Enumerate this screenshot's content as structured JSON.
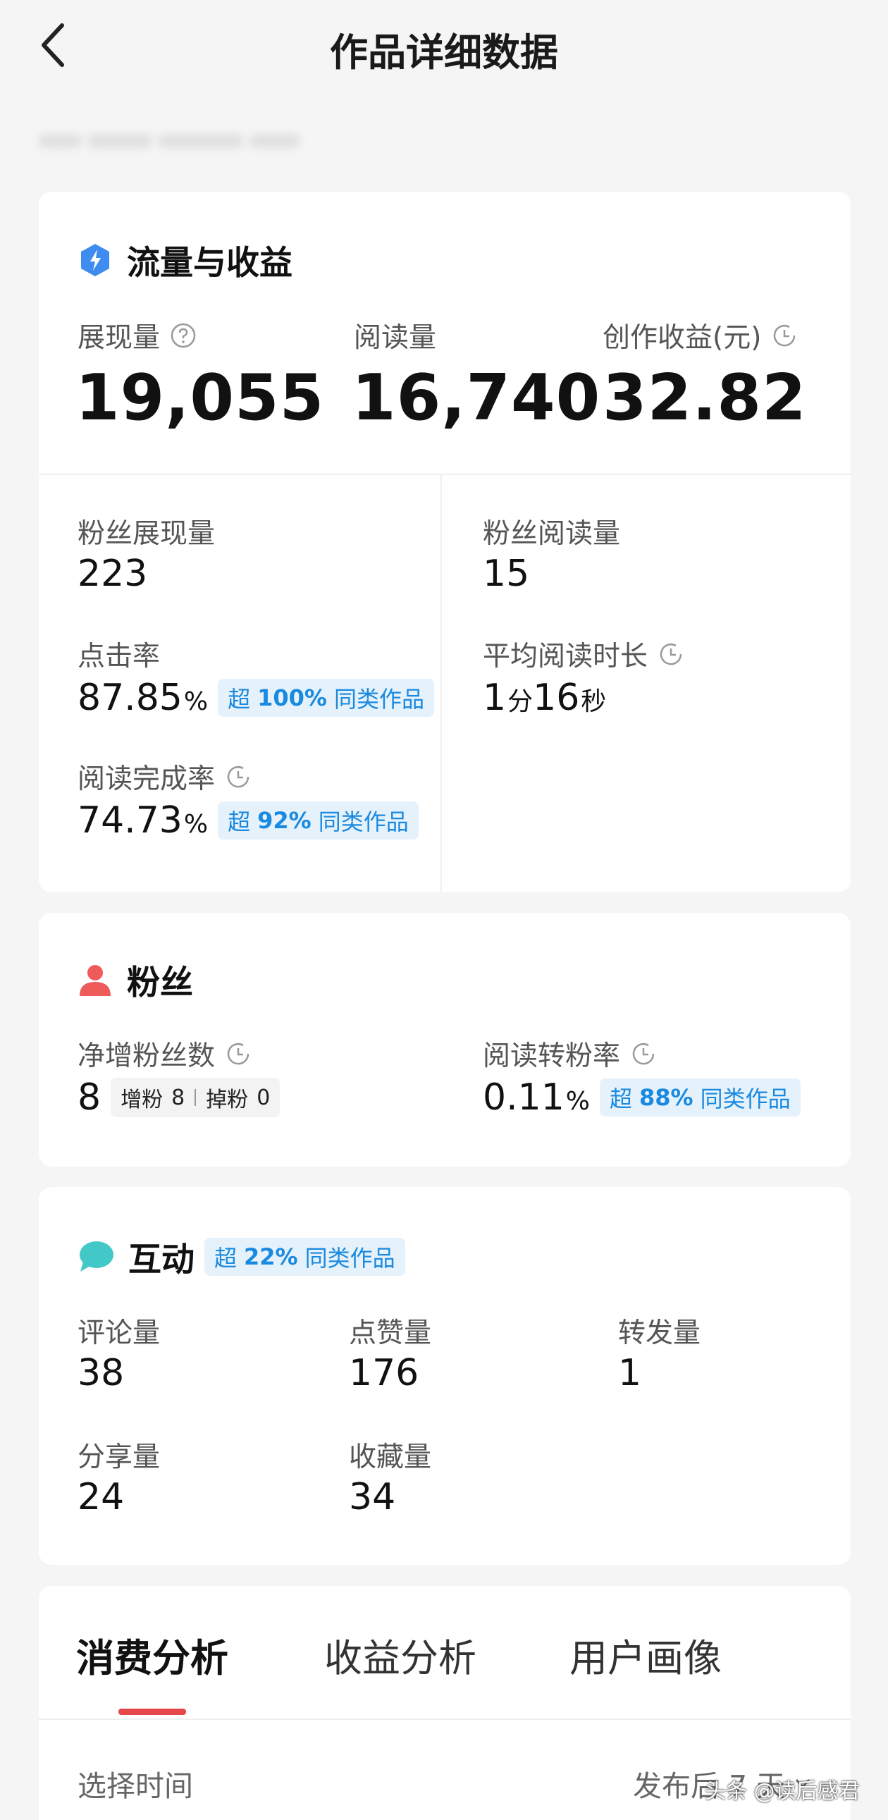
{
  "header": {
    "title": "作品详细数据"
  },
  "traffic": {
    "title": "流量与收益",
    "impressions": {
      "label": "展现量",
      "value": "19,055"
    },
    "reads": {
      "label": "阅读量",
      "value": "16,740"
    },
    "earnings": {
      "label": "创作收益(元)",
      "value": "32.82"
    },
    "fan_impressions": {
      "label": "粉丝展现量",
      "value": "223"
    },
    "fan_reads": {
      "label": "粉丝阅读量",
      "value": "15"
    },
    "ctr": {
      "label": "点击率",
      "value": "87.85",
      "unit": "%",
      "badge_prefix": "超",
      "badge_pct": "100%",
      "badge_suffix": "同类作品"
    },
    "avg_read_time": {
      "label": "平均阅读时长",
      "min": "1",
      "min_unit": "分",
      "sec": "16",
      "sec_unit": "秒"
    },
    "completion": {
      "label": "阅读完成率",
      "value": "74.73",
      "unit": "%",
      "badge_prefix": "超",
      "badge_pct": "92%",
      "badge_suffix": "同类作品"
    }
  },
  "fans": {
    "title": "粉丝",
    "net_gain": {
      "label": "净增粉丝数",
      "value": "8",
      "gain_label": "增粉",
      "gain": "8",
      "loss_label": "掉粉",
      "loss": "0"
    },
    "conversion": {
      "label": "阅读转粉率",
      "value": "0.11",
      "unit": "%",
      "badge_prefix": "超",
      "badge_pct": "88%",
      "badge_suffix": "同类作品"
    }
  },
  "interaction": {
    "title": "互动",
    "badge_prefix": "超",
    "badge_pct": "22%",
    "badge_suffix": "同类作品",
    "comments": {
      "label": "评论量",
      "value": "38"
    },
    "likes": {
      "label": "点赞量",
      "value": "176"
    },
    "reposts": {
      "label": "转发量",
      "value": "1"
    },
    "shares": {
      "label": "分享量",
      "value": "24"
    },
    "favorites": {
      "label": "收藏量",
      "value": "34"
    }
  },
  "tabs": [
    {
      "label": "消费分析",
      "active": true
    },
    {
      "label": "收益分析",
      "active": false
    },
    {
      "label": "用户画像",
      "active": false
    }
  ],
  "time_filter": {
    "label": "选择时间",
    "value": "发布后 7 天"
  },
  "watermark": "头条 @读后感君",
  "colors": {
    "accent_blue": "#1a8ae0",
    "badge_bg": "#e5f1fb",
    "tab_indicator": "#e5474b",
    "fans_icon": "#ef5b5b",
    "interaction_icon": "#43c8c8",
    "traffic_icon": "#3f8cf0"
  }
}
